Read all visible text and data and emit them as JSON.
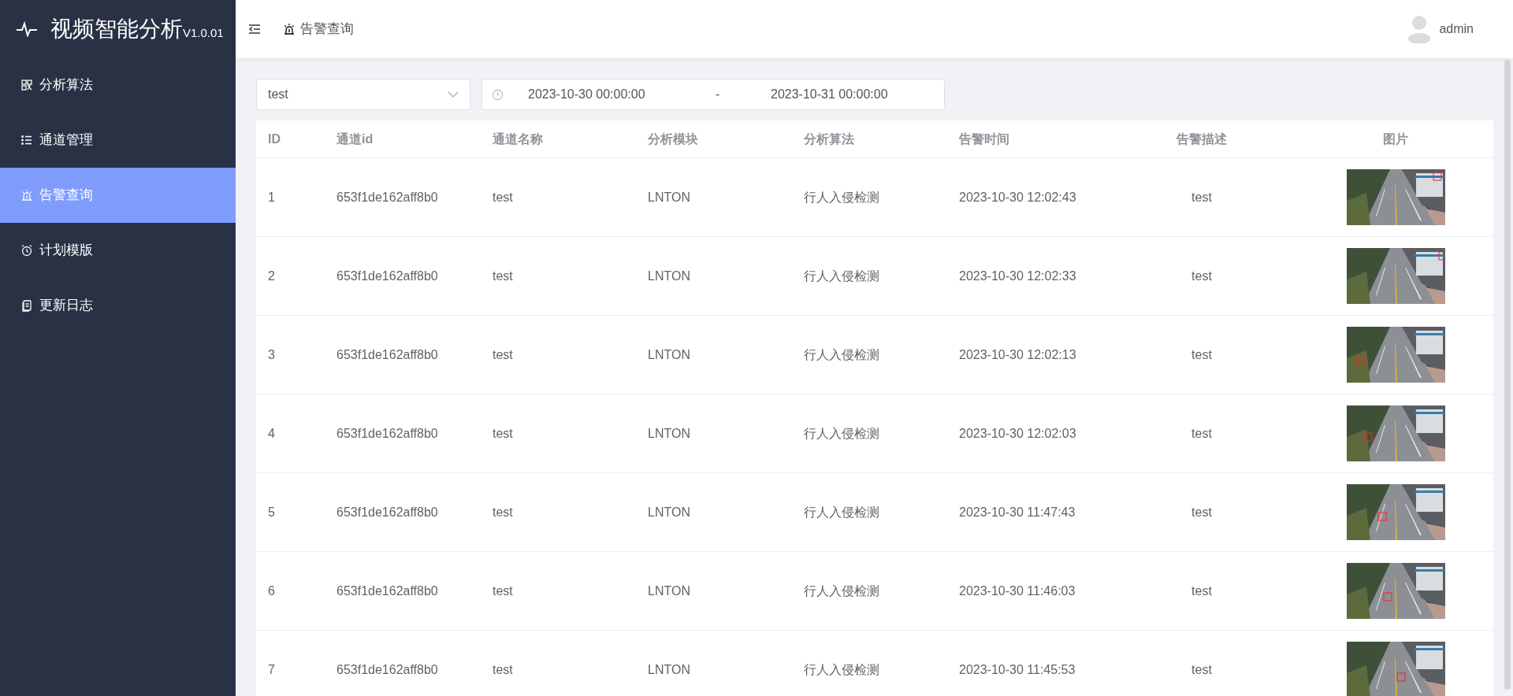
{
  "app": {
    "title": "视频智能分析",
    "version": "V1.0.01"
  },
  "sidebar": {
    "items": [
      {
        "label": "分析算法",
        "selected": false
      },
      {
        "label": "通道管理",
        "selected": false
      },
      {
        "label": "告警查询",
        "selected": true
      },
      {
        "label": "计划模版",
        "selected": false
      },
      {
        "label": "更新日志",
        "selected": false
      }
    ]
  },
  "header": {
    "breadcrumb": "告警查询",
    "user": "admin"
  },
  "filters": {
    "channel": {
      "value": "test"
    },
    "date_range": {
      "start": "2023-10-30 00:00:00",
      "separator": "-",
      "end": "2023-10-31 00:00:00"
    }
  },
  "table": {
    "columns": [
      "ID",
      "通道id",
      "通道名称",
      "分析模块",
      "分析算法",
      "告警时间",
      "告警描述",
      "图片"
    ],
    "rows": [
      {
        "id": "1",
        "channel_id": "653f1de162aff8b0",
        "channel_name": "test",
        "module": "LNTON",
        "algorithm": "行人入侵检测",
        "time": "2023-10-30 12:02:43",
        "description": "test"
      },
      {
        "id": "2",
        "channel_id": "653f1de162aff8b0",
        "channel_name": "test",
        "module": "LNTON",
        "algorithm": "行人入侵检测",
        "time": "2023-10-30 12:02:33",
        "description": "test"
      },
      {
        "id": "3",
        "channel_id": "653f1de162aff8b0",
        "channel_name": "test",
        "module": "LNTON",
        "algorithm": "行人入侵检测",
        "time": "2023-10-30 12:02:13",
        "description": "test"
      },
      {
        "id": "4",
        "channel_id": "653f1de162aff8b0",
        "channel_name": "test",
        "module": "LNTON",
        "algorithm": "行人入侵检测",
        "time": "2023-10-30 12:02:03",
        "description": "test"
      },
      {
        "id": "5",
        "channel_id": "653f1de162aff8b0",
        "channel_name": "test",
        "module": "LNTON",
        "algorithm": "行人入侵检测",
        "time": "2023-10-30 11:47:43",
        "description": "test"
      },
      {
        "id": "6",
        "channel_id": "653f1de162aff8b0",
        "channel_name": "test",
        "module": "LNTON",
        "algorithm": "行人入侵检测",
        "time": "2023-10-30 11:46:03",
        "description": "test"
      },
      {
        "id": "7",
        "channel_id": "653f1de162aff8b0",
        "channel_name": "test",
        "module": "LNTON",
        "algorithm": "行人入侵检测",
        "time": "2023-10-30 11:45:53",
        "description": "test"
      }
    ]
  }
}
